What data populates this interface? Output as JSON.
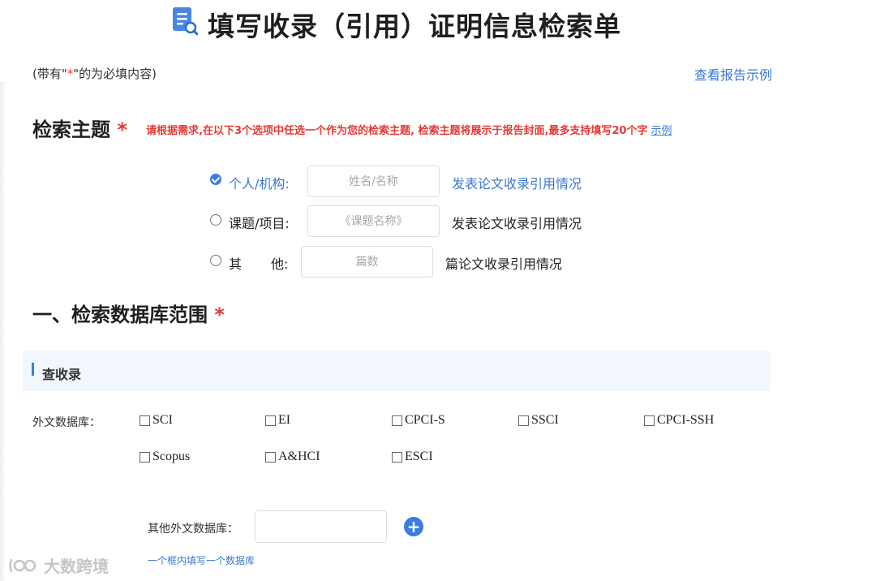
{
  "header": {
    "title": "填写收录（引用）证明信息检索单",
    "required_note_prefix": "(带有\"",
    "required_note_star": "*",
    "required_note_suffix": "\"的为必填内容)",
    "sample_link": "查看报告示例"
  },
  "topic": {
    "title": "检索主题",
    "star": "*",
    "hint": "请根据需求,在以下3个选项中任选一个作为您的检索主题, 检索主题将展示于报告封面,最多支持填写20个字",
    "hint_link": "示例",
    "options": [
      {
        "label": "个人/机构:",
        "placeholder": "姓名/名称",
        "suffix": "发表论文收录引用情况",
        "selected": true
      },
      {
        "label": "课题/项目:",
        "placeholder": "《课题名称》",
        "suffix": "发表论文收录引用情况",
        "selected": false
      },
      {
        "label_a": "其",
        "label_b": "他:",
        "placeholder": "篇数",
        "suffix": "篇论文收录引用情况",
        "selected": false
      }
    ]
  },
  "database": {
    "title": "一、检索数据库范围",
    "star": "*",
    "subsection": "查收录",
    "foreign_label": "外文数据库：",
    "items": [
      "SCI",
      "EI",
      "CPCI-S",
      "SSCI",
      "CPCI-SSH",
      "Scopus",
      "A&HCI",
      "ESCI"
    ],
    "other_label": "其他外文数据库：",
    "other_hint": "一个框内填写一个数据库",
    "add_symbol": "+"
  },
  "watermark": "大数跨境",
  "colors": {
    "accent": "#3b7ddd",
    "required": "#e53935",
    "link": "#3a78d4",
    "sub_bar_bg": "#f2f6fd"
  }
}
